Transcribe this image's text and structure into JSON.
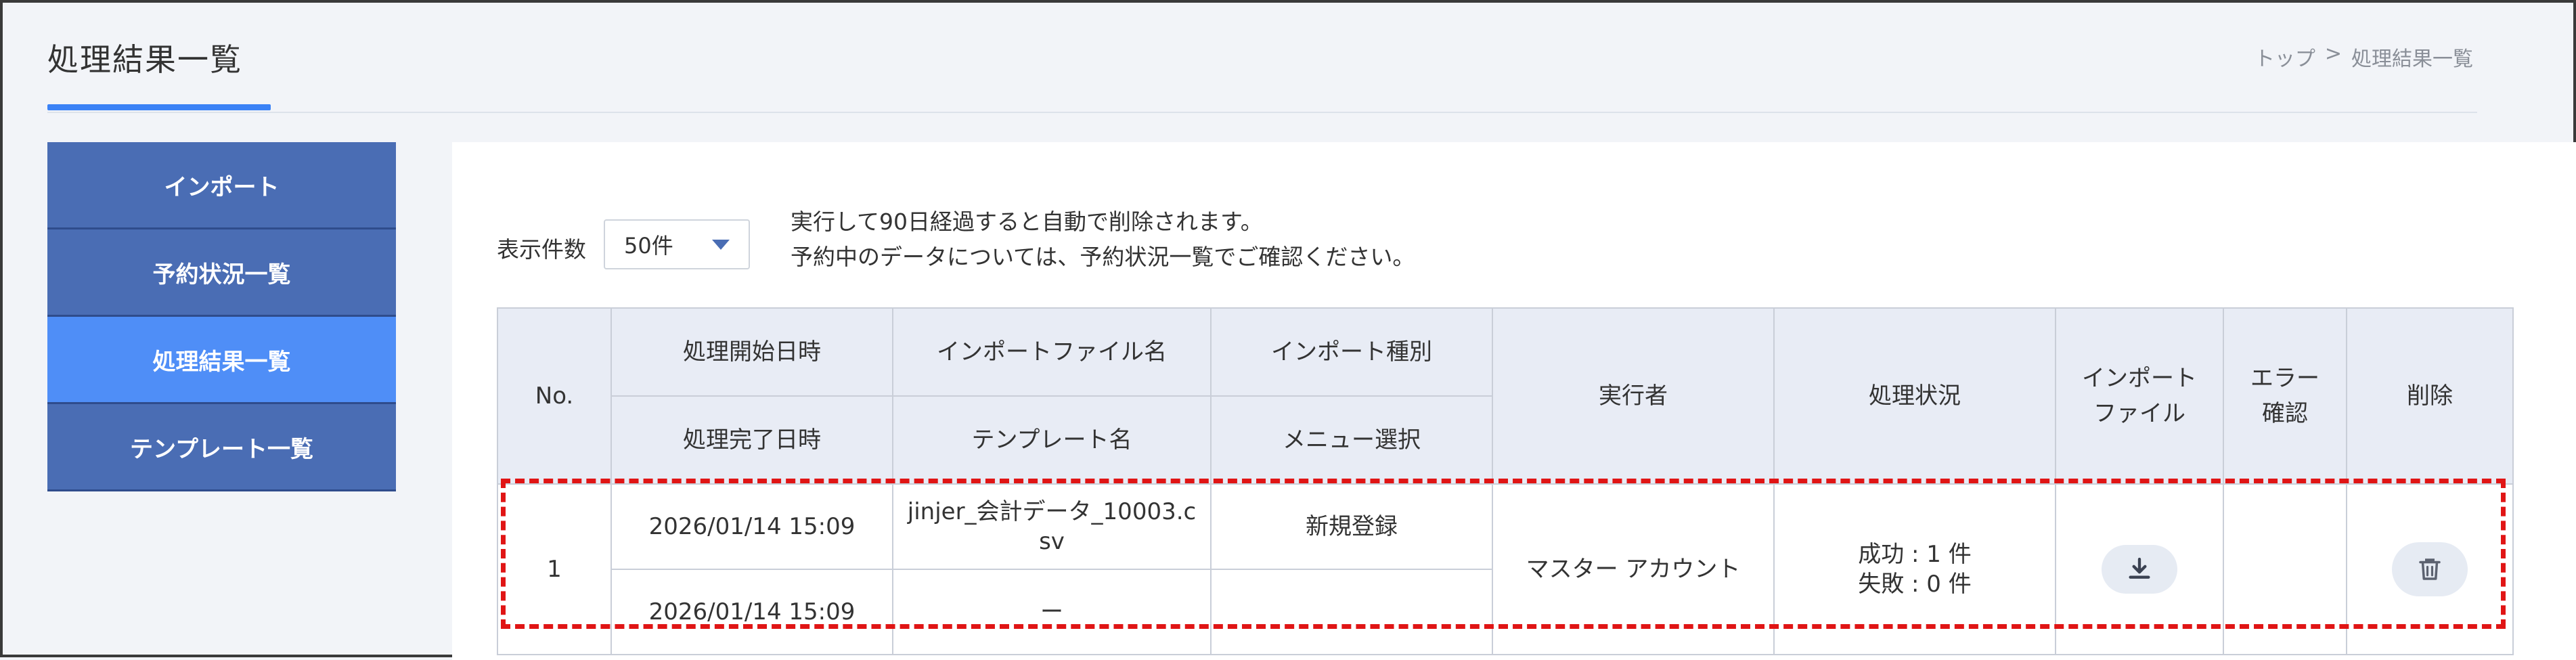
{
  "header": {
    "title": "処理結果一覧",
    "breadcrumb": [
      "トップ",
      ">",
      "処理結果一覧"
    ]
  },
  "sidebar": {
    "items": [
      {
        "label": "インポート",
        "active": false
      },
      {
        "label": "予約状況一覧",
        "active": false
      },
      {
        "label": "処理結果一覧",
        "active": true
      },
      {
        "label": "テンプレート一覧",
        "active": false
      }
    ]
  },
  "toolbar": {
    "count_label": "表示件数",
    "count_select": "50件",
    "notice_line1": "実行して90日経過すると自動で削除されます。",
    "notice_line2": "予約中のデータについては、予約状況一覧でご確認ください。"
  },
  "table": {
    "headers": {
      "no": "No.",
      "start": "処理開始日時",
      "end": "処理完了日時",
      "file": "インポートファイル名",
      "template": "テンプレート名",
      "import_type": "インポート種別",
      "menu": "メニュー選択",
      "executor": "実行者",
      "status": "処理状況",
      "import_file_1": "インポート",
      "import_file_2": "ファイル",
      "error_1": "エラー",
      "error_2": "確認",
      "delete": "削除"
    },
    "rows": [
      {
        "no": "1",
        "start": "2026/01/14 15:09",
        "end": "2026/01/14 15:09",
        "file_line1": "jinjer_会計データ_10003.c",
        "file_line2": "sv",
        "template": "ー",
        "import_type": "新規登録",
        "menu": "",
        "executor": "マスター アカウント",
        "status_success": "成功 : 1 件",
        "status_fail": "失敗 : 0 件"
      }
    ]
  },
  "colors": {
    "sidebar": "#4a6db4",
    "sidebar_active": "#4f8ef7",
    "accent": "#3b82f6",
    "highlight": "#e01515",
    "table_header": "#e8ecf5"
  },
  "icons": [
    "caret-down-icon",
    "download-icon",
    "trash-icon"
  ]
}
